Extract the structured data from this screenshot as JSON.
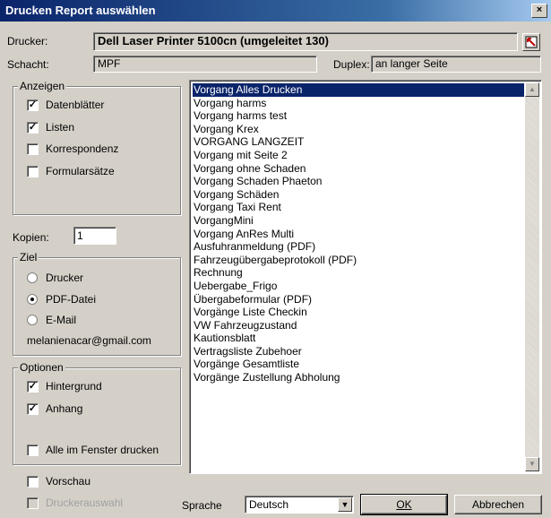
{
  "window": {
    "title": "Drucken Report auswählen",
    "close_glyph": "×"
  },
  "printer": {
    "label": "Drucker:",
    "value": "Dell Laser Printer 5100cn (umgeleitet 130)",
    "icon": "printer-select-icon"
  },
  "tray": {
    "label": "Schacht:",
    "value": "MPF"
  },
  "duplex": {
    "label": "Duplex:",
    "value": "an langer Seite"
  },
  "show_group": {
    "legend": "Anzeigen",
    "items": [
      {
        "label": "Datenblätter",
        "checked": true
      },
      {
        "label": "Listen",
        "checked": true
      },
      {
        "label": "Korrespondenz",
        "checked": false
      },
      {
        "label": "Formularsätze",
        "checked": false
      }
    ]
  },
  "copies": {
    "label": "Kopien:",
    "value": "1"
  },
  "target_group": {
    "legend": "Ziel",
    "options": [
      {
        "label": "Drucker",
        "selected": false
      },
      {
        "label": "PDF-Datei",
        "selected": true
      },
      {
        "label": "E-Mail",
        "selected": false
      }
    ],
    "email": "melanienacar@gmail.com"
  },
  "options_group": {
    "legend": "Optionen",
    "items": [
      {
        "label": "Hintergrund",
        "checked": true
      },
      {
        "label": "Anhang",
        "checked": true
      },
      {
        "label": "Alle im Fenster drucken",
        "checked": false
      }
    ]
  },
  "preview": {
    "label": "Vorschau",
    "checked": false
  },
  "printer_select": {
    "label": "Druckerauswahl",
    "checked": false,
    "disabled": true
  },
  "reports": [
    "Vorgang Alles Drucken",
    "Vorgang harms",
    "Vorgang harms test",
    "Vorgang Krex",
    "VORGANG LANGZEIT",
    "Vorgang mit Seite 2",
    "Vorgang ohne Schaden",
    "Vorgang Schaden Phaeton",
    "Vorgang Schäden",
    "Vorgang Taxi Rent",
    "VorgangMini",
    "Vorgang AnRes Multi",
    "Ausfuhranmeldung (PDF)",
    "Fahrzeugübergabeprotokoll (PDF)",
    "Rechnung",
    "Uebergabe_Frigo",
    "Übergabeformular (PDF)",
    "Vorgänge Liste Checkin",
    "VW Fahrzeugzustand",
    "Kautionsblatt",
    "Vertragsliste Zubehoer",
    "Vorgänge Gesamtliste",
    "Vorgänge Zustellung Abholung"
  ],
  "selected_report_index": 0,
  "language": {
    "label": "Sprache",
    "value": "Deutsch"
  },
  "buttons": {
    "ok": "OK",
    "cancel": "Abbrechen"
  },
  "colors": {
    "title_bar": "#0a246a",
    "selection": "#0a246a",
    "face": "#d4d0c8"
  }
}
